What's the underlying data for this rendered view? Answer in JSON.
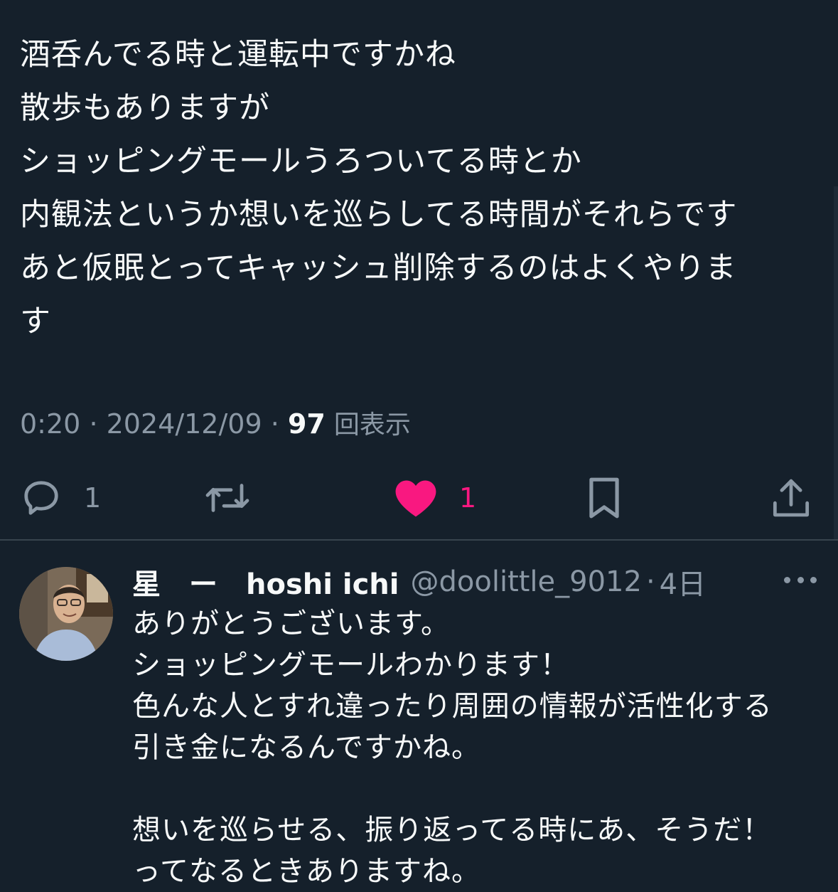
{
  "post": {
    "lines": [
      "酒呑んでる時と運転中ですかね",
      "散歩もありますが",
      "ショッピングモールうろついてる時とか",
      "内観法というか想いを巡らしてる時間がそれらです",
      "あと仮眠とってキャッシュ削除するのはよくやりま",
      "す"
    ],
    "time": "0:20",
    "separator": "·",
    "date": "2024/12/09",
    "views_count": "97",
    "views_label": "回表示"
  },
  "actions": {
    "reply_count": "1",
    "like_count": "1",
    "icons": [
      "reply-icon",
      "retweet-icon",
      "heart-icon",
      "bookmark-icon",
      "share-icon"
    ],
    "like_color": "#f91880",
    "icon_color": "#8b98a5"
  },
  "reply": {
    "display_name": "星　ー　hoshi ichi",
    "handle": "@doolittle_9012",
    "separator": "·",
    "age": "4日",
    "lines": [
      "ありがとうございます。",
      "ショッピングモールわかります！",
      "色んな人とすれ違ったり周囲の情報が活性化する",
      "引き金になるんですかね。",
      "",
      "想いを巡らせる、振り返ってる時にあ、そうだ！",
      "ってなるときありますね。"
    ]
  },
  "colors": {
    "background": "#15202b",
    "text": "#f7f9f9",
    "muted": "#8b98a5",
    "divider": "#38444d"
  }
}
